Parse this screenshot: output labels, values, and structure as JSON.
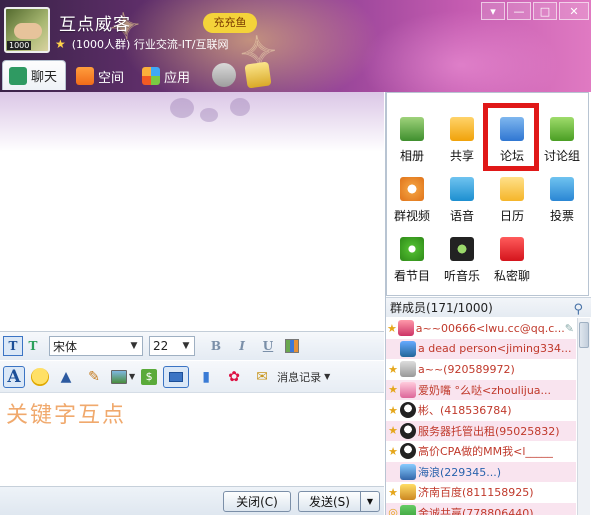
{
  "window": {
    "title": "互点威客",
    "subtitle": "(1000人群) 行业交流-IT/互联网",
    "controls": [
      "▾",
      "—",
      "□",
      "✕"
    ]
  },
  "header_decor": {
    "badge": "充充鱼"
  },
  "tabs": [
    {
      "label": "聊天",
      "icon": "chat-icon",
      "active": true
    },
    {
      "label": "空间",
      "icon": "house-icon",
      "active": false
    },
    {
      "label": "应用",
      "icon": "apps-icon",
      "active": false
    }
  ],
  "font_toolbar": {
    "font_family": "宋体",
    "font_size": "22",
    "bold": "B",
    "italic": "I",
    "underline": "U"
  },
  "toolbar": {
    "font_btn": "A",
    "message_record": "消息记录",
    "icons": [
      "font-icon",
      "smiley-icon",
      "hat-icon",
      "pen-icon",
      "image-icon",
      "money-icon",
      "screenshot-icon",
      "chart-icon",
      "gift-icon",
      "note-icon"
    ]
  },
  "input": {
    "typed_text": "关键字互点",
    "text_color": "#f0a96d"
  },
  "buttons": {
    "close": "关闭(C)",
    "send": "发送(S)"
  },
  "apps": [
    {
      "label": "相册",
      "icon": "photo-album-icon"
    },
    {
      "label": "共享",
      "icon": "folder-share-icon"
    },
    {
      "label": "论坛",
      "icon": "forum-icon",
      "highlighted": true
    },
    {
      "label": "讨论组",
      "icon": "discussion-group-icon"
    },
    {
      "label": "群视频",
      "icon": "group-video-icon"
    },
    {
      "label": "语音",
      "icon": "voice-icon"
    },
    {
      "label": "日历",
      "icon": "calendar-icon"
    },
    {
      "label": "投票",
      "icon": "vote-icon"
    },
    {
      "label": "看节目",
      "icon": "show-icon"
    },
    {
      "label": "听音乐",
      "icon": "music-icon"
    },
    {
      "label": "私密聊",
      "icon": "secret-chat-icon"
    }
  ],
  "members": {
    "header": "群成员(171/1000)",
    "list": [
      {
        "name": "a~~00666<lwu.cc@qq.c...",
        "color": "red"
      },
      {
        "name": "a dead person<jiming334...",
        "color": "red"
      },
      {
        "name": "a~~(920589972)",
        "color": "red"
      },
      {
        "name": "爱奶嘴  °么哒<zhoulijua...",
        "color": "red"
      },
      {
        "name": "彬、(418536784)",
        "color": "red"
      },
      {
        "name": "服务器托管出租(95025832)",
        "color": "red"
      },
      {
        "name": "高价CPA做的MM我<l_____",
        "color": "red"
      },
      {
        "name": "海浪(229345...)",
        "color": "blue"
      },
      {
        "name": "济南百度(811158925)",
        "color": "red"
      },
      {
        "name": "金诚共赢(778806440)",
        "color": "red"
      }
    ]
  },
  "colors": {
    "accent": "#3b74c4",
    "highlight_box": "#e01818",
    "member_name": "#c0392b"
  }
}
